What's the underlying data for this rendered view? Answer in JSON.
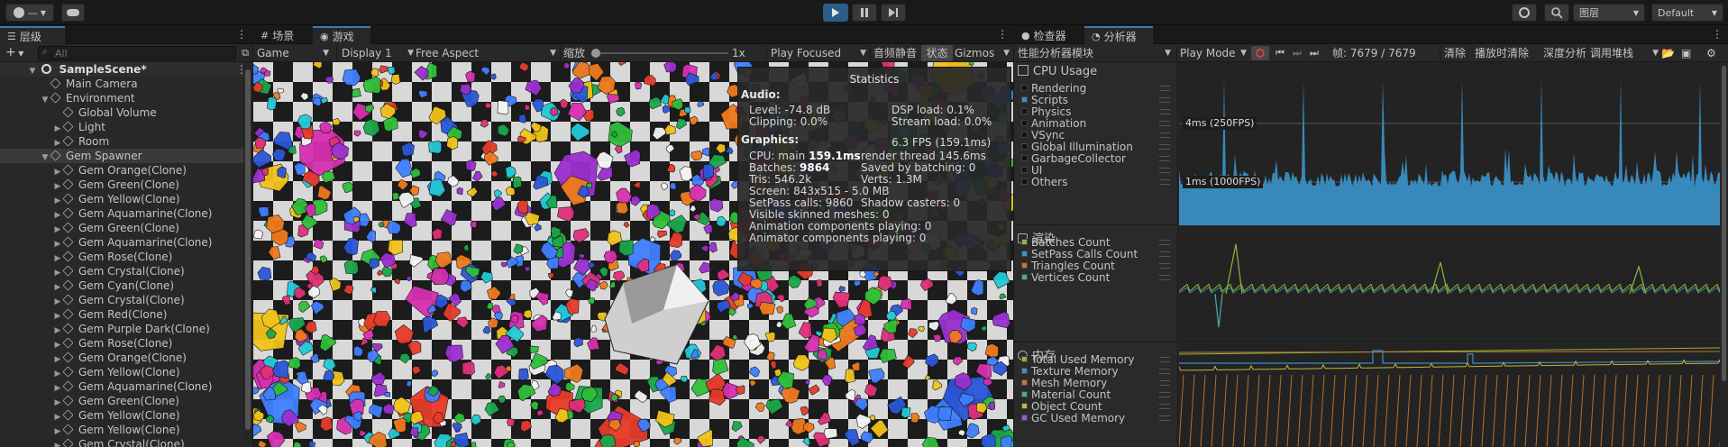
{
  "toolbar": {
    "account_label": "—",
    "play_icon": "play-icon",
    "pause_icon": "pause-icon",
    "step_icon": "step-icon",
    "layers_label": "图层",
    "layout_label": "Default"
  },
  "hierarchy": {
    "tab_label": "层级",
    "add_label": "+",
    "search_placeholder": "All",
    "scene_name": "SampleScene*",
    "items": [
      {
        "label": "Main Camera",
        "indent": 1,
        "arrow": ""
      },
      {
        "label": "Environment",
        "indent": 1,
        "arrow": "▼"
      },
      {
        "label": "Global Volume",
        "indent": 2,
        "arrow": ""
      },
      {
        "label": "Light",
        "indent": 2,
        "arrow": "▶"
      },
      {
        "label": "Room",
        "indent": 2,
        "arrow": "▶"
      },
      {
        "label": "Gem Spawner",
        "indent": 1,
        "arrow": "▼",
        "selected": true
      },
      {
        "label": "Gem Orange(Clone)",
        "indent": 2,
        "arrow": "▶"
      },
      {
        "label": "Gem Green(Clone)",
        "indent": 2,
        "arrow": "▶"
      },
      {
        "label": "Gem Yellow(Clone)",
        "indent": 2,
        "arrow": "▶"
      },
      {
        "label": "Gem Aquamarine(Clone)",
        "indent": 2,
        "arrow": "▶"
      },
      {
        "label": "Gem Green(Clone)",
        "indent": 2,
        "arrow": "▶"
      },
      {
        "label": "Gem Aquamarine(Clone)",
        "indent": 2,
        "arrow": "▶"
      },
      {
        "label": "Gem Rose(Clone)",
        "indent": 2,
        "arrow": "▶"
      },
      {
        "label": "Gem Crystal(Clone)",
        "indent": 2,
        "arrow": "▶"
      },
      {
        "label": "Gem Cyan(Clone)",
        "indent": 2,
        "arrow": "▶"
      },
      {
        "label": "Gem Crystal(Clone)",
        "indent": 2,
        "arrow": "▶"
      },
      {
        "label": "Gem Red(Clone)",
        "indent": 2,
        "arrow": "▶"
      },
      {
        "label": "Gem Purple Dark(Clone)",
        "indent": 2,
        "arrow": "▶"
      },
      {
        "label": "Gem Rose(Clone)",
        "indent": 2,
        "arrow": "▶"
      },
      {
        "label": "Gem Orange(Clone)",
        "indent": 2,
        "arrow": "▶"
      },
      {
        "label": "Gem Yellow(Clone)",
        "indent": 2,
        "arrow": "▶"
      },
      {
        "label": "Gem Aquamarine(Clone)",
        "indent": 2,
        "arrow": "▶"
      },
      {
        "label": "Gem Green(Clone)",
        "indent": 2,
        "arrow": "▶"
      },
      {
        "label": "Gem Yellow(Clone)",
        "indent": 2,
        "arrow": "▶"
      },
      {
        "label": "Gem Yellow(Clone)",
        "indent": 2,
        "arrow": "▶"
      },
      {
        "label": "Gem Crystal(Clone)",
        "indent": 2,
        "arrow": "▶"
      }
    ]
  },
  "game": {
    "tab_scene": "场景",
    "tab_game": "游戏",
    "view_mode": "Game",
    "display": "Display 1",
    "aspect": "Free Aspect",
    "scale_label": "缩放",
    "scale_value": "1x",
    "play_focus": "Play Focused",
    "mute_label": "音频静音",
    "stats_label": "状态",
    "gizmos_label": "Gizmos"
  },
  "statistics": {
    "title": "Statistics",
    "audio_header": "Audio:",
    "level": "Level: -74.8 dB",
    "clipping": "Clipping: 0.0%",
    "dsp": "DSP load: 0.1%",
    "stream": "Stream load: 0.0%",
    "graphics_header": "Graphics:",
    "fps": "6.3 FPS (159.1ms)",
    "cpu_prefix": "CPU: main ",
    "cpu_main": "159.1ms",
    "render_thread": "render thread 145.6ms",
    "batches_prefix": "Batches: ",
    "batches": "9864",
    "saved": "Saved by batching: 0",
    "tris": "Tris: 546.2k",
    "verts": "Verts: 1.3M",
    "screen": "Screen: 843x515 - 5.0 MB",
    "setpass": "SetPass calls: 9860",
    "shadow": "Shadow casters: 0",
    "skinned": "Visible skinned meshes: 0",
    "anim": "Animation components playing: 0",
    "animator": "Animator components playing: 0"
  },
  "profiler": {
    "tab_inspector": "检查器",
    "tab_profiler": "分析器",
    "modules_label": "性能分析器模块",
    "mode": "Play Mode",
    "frame_label": "帧: 7679 / 7679",
    "clear": "清除",
    "clear_on_play": "播放时清除",
    "deep": "深度分析",
    "callstacks": "调用堆栈",
    "cpu": {
      "title": "CPU Usage",
      "label_4ms": "4ms (250FPS)",
      "label_1ms": "1ms (1000FPS)",
      "legend": [
        {
          "name": "Rendering",
          "color": "#111111"
        },
        {
          "name": "Scripts",
          "color": "#3a8fc4"
        },
        {
          "name": "Physics",
          "color": "#111111"
        },
        {
          "name": "Animation",
          "color": "#111111"
        },
        {
          "name": "VSync",
          "color": "#111111"
        },
        {
          "name": "Global Illumination",
          "color": "#111111"
        },
        {
          "name": "GarbageCollector",
          "color": "#111111"
        },
        {
          "name": "UI",
          "color": "#111111"
        },
        {
          "name": "Others",
          "color": "#111111"
        }
      ]
    },
    "render": {
      "title": "渲染",
      "legend": [
        {
          "name": "Batches Count",
          "color": "#8bb63c"
        },
        {
          "name": "SetPass Calls Count",
          "color": "#3a8fc4"
        },
        {
          "name": "Triangles Count",
          "color": "#c8782a"
        },
        {
          "name": "Vertices Count",
          "color": "#4aa8a8"
        }
      ]
    },
    "memory": {
      "title": "内存",
      "legend": [
        {
          "name": "Total Used Memory",
          "color": "#8bb63c"
        },
        {
          "name": "Texture Memory",
          "color": "#3a8fc4"
        },
        {
          "name": "Mesh Memory",
          "color": "#c8782a"
        },
        {
          "name": "Material Count",
          "color": "#4aa8a8"
        },
        {
          "name": "Object Count",
          "color": "#c9b23a"
        },
        {
          "name": "GC Used Memory",
          "color": "#9a5cc0"
        }
      ]
    }
  }
}
